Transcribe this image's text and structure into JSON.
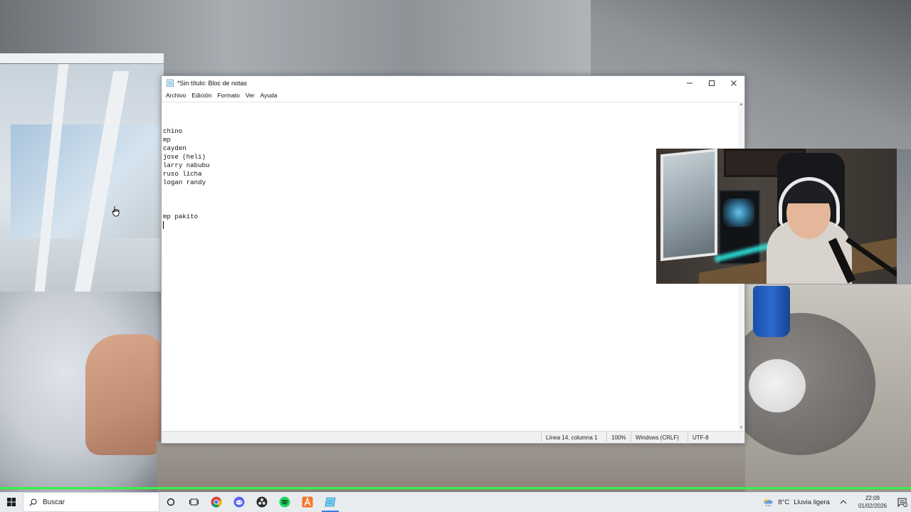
{
  "notepad": {
    "title": "*Sin título: Bloc de notas",
    "menu": [
      "Archivo",
      "Edición",
      "Formato",
      "Ver",
      "Ayuda"
    ],
    "lines": [
      "",
      "chino",
      "mp",
      "cayden",
      "jose (heli)",
      "larry nabubu",
      "ruso licha",
      "logan randy",
      "",
      "",
      "",
      "mp pakito",
      ""
    ],
    "status": {
      "position": "Línea 14, columna 1",
      "zoom": "100%",
      "line_ending": "Windows (CRLF)",
      "encoding": "UTF-8"
    }
  },
  "taskbar": {
    "search_placeholder": "Buscar",
    "weather_temp": "8°C",
    "weather_text": "Lluvia ligera",
    "time": "22:09",
    "date": "01/02/2026",
    "notification_badge": "1"
  },
  "colors": {
    "accent_green": "#39f04a",
    "taskbar_bg": "#e9ecef"
  }
}
